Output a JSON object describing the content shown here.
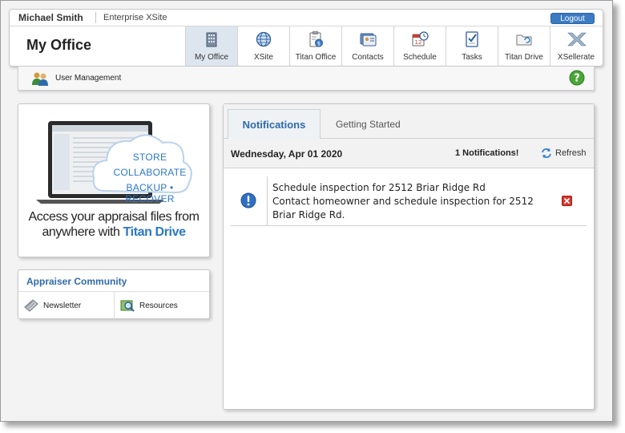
{
  "user": {
    "name": "Michael Smith",
    "site": "Enterprise XSite"
  },
  "logout_label": "Logout",
  "page_title": "My Office",
  "nav": [
    {
      "label": "My Office",
      "icon": "building-icon",
      "active": true
    },
    {
      "label": "XSite",
      "icon": "globe-icon"
    },
    {
      "label": "Titan Office",
      "icon": "clipboard-money-icon"
    },
    {
      "label": "Contacts",
      "icon": "contacts-icon"
    },
    {
      "label": "Schedule",
      "icon": "calendar-clock-icon"
    },
    {
      "label": "Tasks",
      "icon": "checklist-icon"
    },
    {
      "label": "Titan Drive",
      "icon": "folder-sync-icon"
    },
    {
      "label": "XSellerate",
      "icon": "xsellerate-logo-icon"
    }
  ],
  "toolbar": {
    "user_management": "User Management",
    "help_icon": "help-icon"
  },
  "promo": {
    "cloud_lines": [
      "STORE",
      "COLLABORATE",
      "BACKUP • RECOVER"
    ],
    "line1": "Access your appraisal files from",
    "line2_prefix": "anywhere with ",
    "line2_brand": "Titan Drive"
  },
  "community": {
    "title": "Appraiser Community",
    "links": [
      {
        "label": "Newsletter",
        "icon": "newsletter-icon"
      },
      {
        "label": "Resources",
        "icon": "resources-icon"
      }
    ]
  },
  "notifications": {
    "tabs": [
      "Notifications",
      "Getting Started"
    ],
    "date": "Wednesday, Apr 01 2020",
    "count": "1 Notifications!",
    "refresh": "Refresh",
    "items": [
      {
        "title": "Schedule inspection for 2512 Briar Ridge Rd",
        "body": "Contact homeowner and schedule inspection for 2512 Briar Ridge Rd."
      }
    ]
  },
  "colors": {
    "accent": "#2f6aad",
    "logout": "#3b7bc4",
    "active_nav": "#dde6ef"
  }
}
